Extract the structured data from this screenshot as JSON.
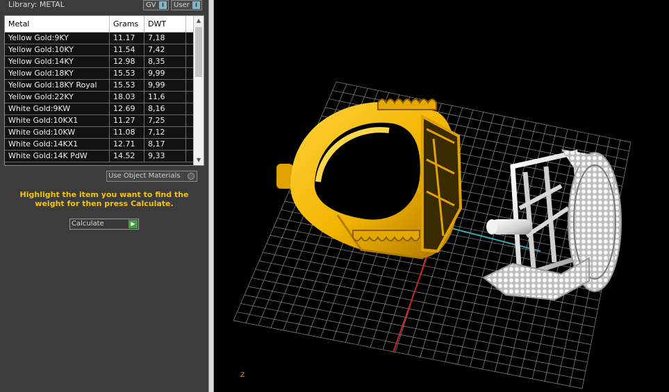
{
  "panel": {
    "library_title": "Library: METAL",
    "toggles": [
      {
        "label": "GV",
        "mark": "I"
      },
      {
        "label": "User",
        "mark": "I"
      }
    ],
    "table": {
      "columns": [
        "Metal",
        "Grams",
        "DWT"
      ],
      "rows": [
        {
          "metal": "Yellow Gold:9KY",
          "grams": "11.17",
          "dwt": "7,18"
        },
        {
          "metal": "Yellow Gold:10KY",
          "grams": "11.54",
          "dwt": "7,42"
        },
        {
          "metal": "Yellow Gold:14KY",
          "grams": "12.98",
          "dwt": "8,35"
        },
        {
          "metal": "Yellow Gold:18KY",
          "grams": "15.53",
          "dwt": "9,99"
        },
        {
          "metal": "Yellow Gold:18KY Royal",
          "grams": "15.53",
          "dwt": "9,99"
        },
        {
          "metal": "Yellow Gold:22KY",
          "grams": "18.03",
          "dwt": "11,6"
        },
        {
          "metal": "White Gold:9KW",
          "grams": "12.69",
          "dwt": "8,16"
        },
        {
          "metal": "White Gold:10KX1",
          "grams": "11.27",
          "dwt": "7,25"
        },
        {
          "metal": "White Gold:10KW",
          "grams": "11.08",
          "dwt": "7,12"
        },
        {
          "metal": "White Gold:14KX1",
          "grams": "12.71",
          "dwt": "8,17"
        },
        {
          "metal": "White Gold:14K PdW",
          "grams": "14.52",
          "dwt": "9,33"
        }
      ]
    },
    "use_object_materials": "Use Object Materials",
    "hint": "Highlight the item you want to find the weight for then press Calculate.",
    "calculate_label": "Calculate"
  },
  "viewport": {
    "axis_label": "Z"
  },
  "colors": {
    "panel_bg": "#3c3c3c",
    "hint": "#f3c40a",
    "gold": "#f2b400",
    "silver": "#d8d8d8",
    "x_axis": "#c62828",
    "y_axis": "#3aa9b8",
    "toggle_accent": "#7fb8c8"
  }
}
